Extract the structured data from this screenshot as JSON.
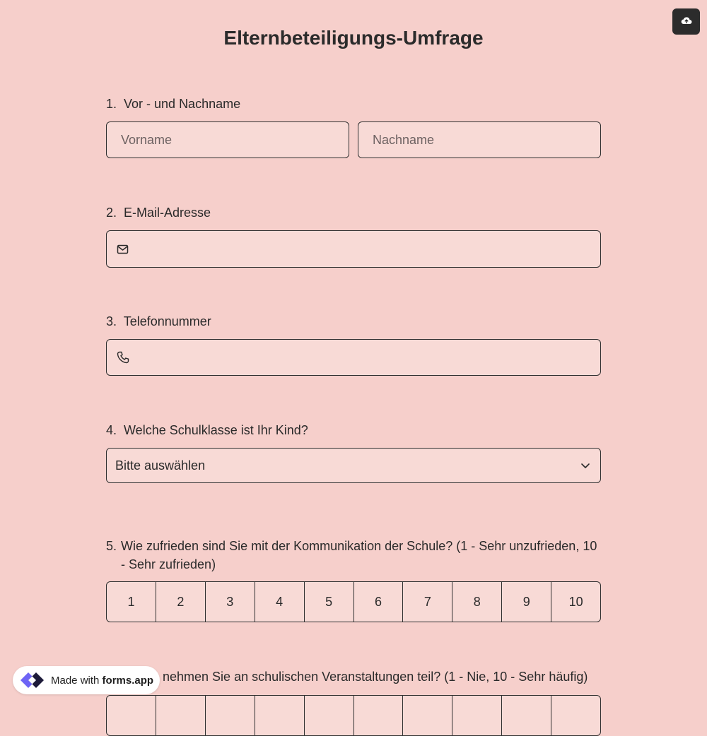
{
  "form": {
    "title": "Elternbeteiligungs-Umfrage",
    "upload_icon": "cloud-upload-icon"
  },
  "q1": {
    "number": "1.",
    "label": "Vor - und Nachname",
    "first_placeholder": "Vorname",
    "last_placeholder": "Nachname"
  },
  "q2": {
    "number": "2.",
    "label": "E-Mail-Adresse",
    "icon": "mail-icon",
    "value": ""
  },
  "q3": {
    "number": "3.",
    "label": "Telefonnummer",
    "icon": "phone-icon",
    "value": ""
  },
  "q4": {
    "number": "4.",
    "label": "Welche Schulklasse ist Ihr Kind?",
    "selected": "Bitte auswählen",
    "icon": "chevron-down-icon"
  },
  "q5": {
    "number": "5.",
    "label": "Wie zufrieden sind Sie mit der Kommunikation der Schule? (1 - Sehr unzufrieden, 10 - Sehr zufrieden)",
    "options": [
      "1",
      "2",
      "3",
      "4",
      "5",
      "6",
      "7",
      "8",
      "9",
      "10"
    ]
  },
  "q6": {
    "label_visible": "nehmen Sie an schulischen Veranstaltungen teil? (1 - Nie, 10 - Sehr häufig)"
  },
  "badge": {
    "prefix": "Made with",
    "brand": "forms.app"
  },
  "colors": {
    "background": "#f6cfcb",
    "field": "#f8dad6",
    "border": "#2f2f2f",
    "button": "#2c2c2c"
  }
}
